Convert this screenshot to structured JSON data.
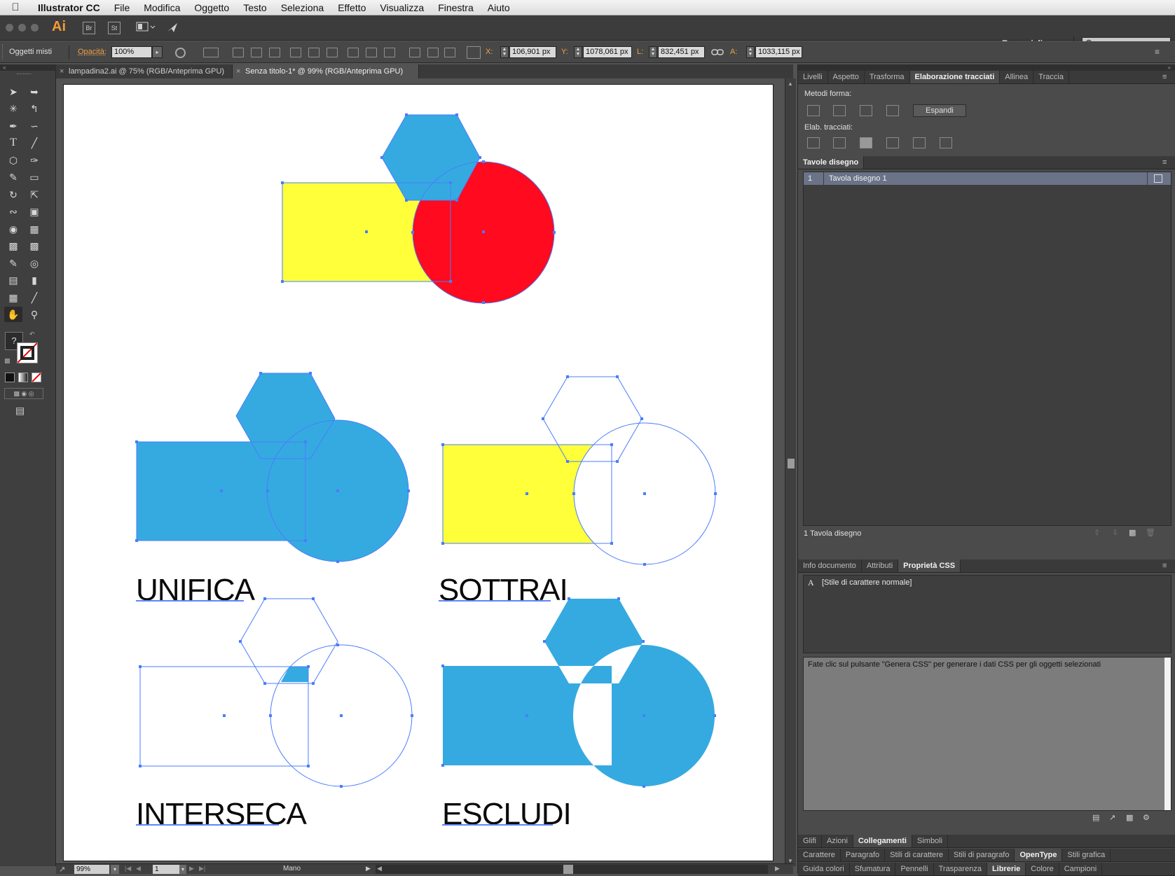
{
  "menubar": {
    "app": "Illustrator CC",
    "items": [
      "File",
      "Modifica",
      "Oggetto",
      "Testo",
      "Seleziona",
      "Effetto",
      "Visualizza",
      "Finestra",
      "Aiuto"
    ]
  },
  "appbar": {
    "logo": "Ai",
    "bridge": "Br",
    "stock": "St",
    "workspace": "Essenziali",
    "search_placeholder": "",
    "search_icon": "magnifier-icon"
  },
  "control": {
    "selection": "Oggetti misti",
    "opacity_label": "Opacità:",
    "opacity_value": "100%",
    "x_label": "X:",
    "x_value": "106,901 px",
    "y_label": "Y:",
    "y_value": "1078,061 px",
    "w_label": "L:",
    "w_value": "832,451 px",
    "h_label": "A:",
    "h_value": "1033,115 px"
  },
  "tabs": [
    {
      "label": "lampadina2.ai @ 75% (RGB/Anteprima GPU)"
    },
    {
      "label": "Senza titolo-1* @ 99% (RGB/Anteprima GPU)"
    }
  ],
  "artboard": {
    "labels": {
      "unifica": "UNIFICA",
      "sottrai": "SOTTRAI",
      "interseca": "INTERSECA",
      "escludi": "ESCLUDI"
    },
    "colors": {
      "yellow": "#ffff3a",
      "red": "#ff0a1e",
      "blue": "#35aae0",
      "selection": "#4a7cff"
    }
  },
  "status": {
    "zoom": "99%",
    "page": "1",
    "tool": "Mano"
  },
  "panel_pathfinder": {
    "tabs": [
      "Livelli",
      "Aspetto",
      "Trasforma",
      "Elaborazione tracciati",
      "Allinea",
      "Traccia"
    ],
    "active": "Elaborazione tracciati",
    "shape_modes": "Metodi forma:",
    "expand": "Espandi",
    "pathfinders": "Elab. tracciati:"
  },
  "panel_artboards": {
    "tab": "Tavole disegno",
    "row_index": "1",
    "row_name": "Tavola disegno 1",
    "footer": "1 Tavola disegno"
  },
  "panel_css": {
    "tabs": [
      "Info documento",
      "Attributi",
      "Proprietà CSS"
    ],
    "active": "Proprietà CSS",
    "style_item": "[Stile di carattere normale]",
    "message": "Fate clic sul pulsante \"Genera CSS\" per generare i dati CSS per gli oggetti selezionati"
  },
  "bottom_tabs": {
    "row1": [
      "Glifi",
      "Azioni",
      "Collegamenti",
      "Simboli"
    ],
    "row1_active": "Collegamenti",
    "row2": [
      "Carattere",
      "Paragrafo",
      "Stili di carattere",
      "Stili di paragrafo",
      "OpenType",
      "Stili grafica"
    ],
    "row2_active": "OpenType",
    "row3": [
      "Guida colori",
      "Sfumatura",
      "Pennelli",
      "Trasparenza",
      "Librerie",
      "Colore",
      "Campioni"
    ],
    "row3_active": "Librerie"
  }
}
